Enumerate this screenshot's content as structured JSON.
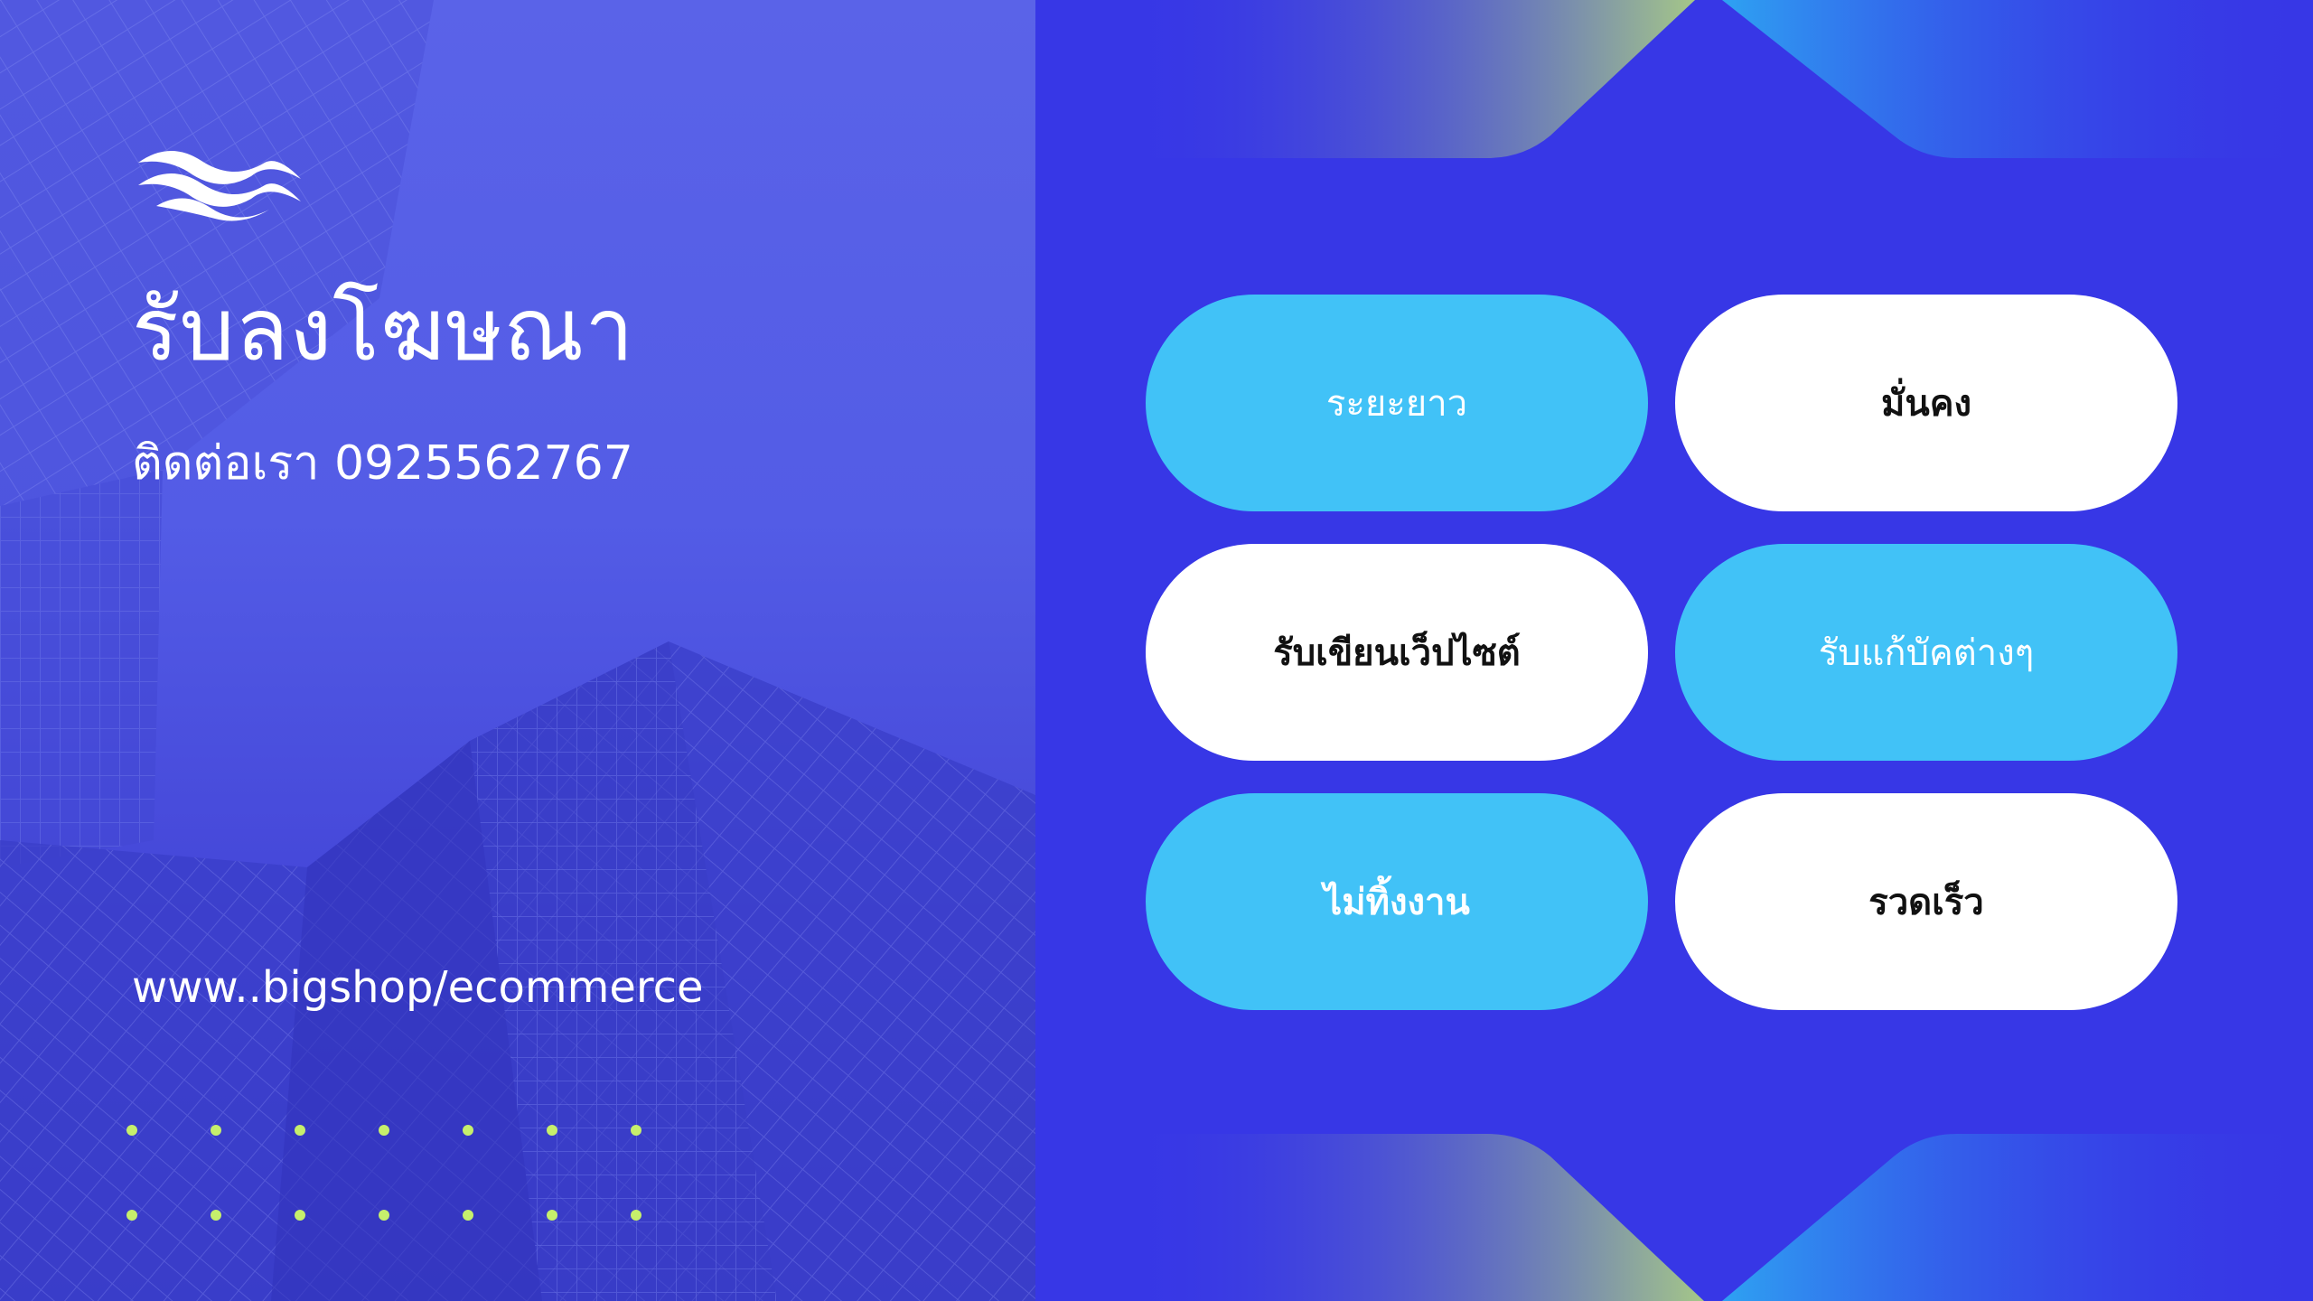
{
  "header": {
    "title": "รับลงโฆษณา",
    "contact": "ติดต่อเรา 0925562767"
  },
  "footer": {
    "website": "www..bigshop/ecommerce"
  },
  "icons": {
    "logo": "wave-logo-icon"
  },
  "colors": {
    "left_panel": "#5a63e8",
    "right_panel": "#3737e6",
    "pill_blue": "#41c2f7",
    "pill_white": "#ffffff",
    "dots": "#c6ef6c"
  },
  "features": [
    {
      "label": "ระยะยาว",
      "style": "blue"
    },
    {
      "label": "มั่นคง",
      "style": "white"
    },
    {
      "label": "รับเขียนเว็ปไซต์",
      "style": "white"
    },
    {
      "label": "รับแก้บัคต่างๆ",
      "style": "blue"
    },
    {
      "label": "ไม่ทิ้งงาน",
      "style": "blue"
    },
    {
      "label": "รวดเร็ว",
      "style": "white"
    }
  ]
}
